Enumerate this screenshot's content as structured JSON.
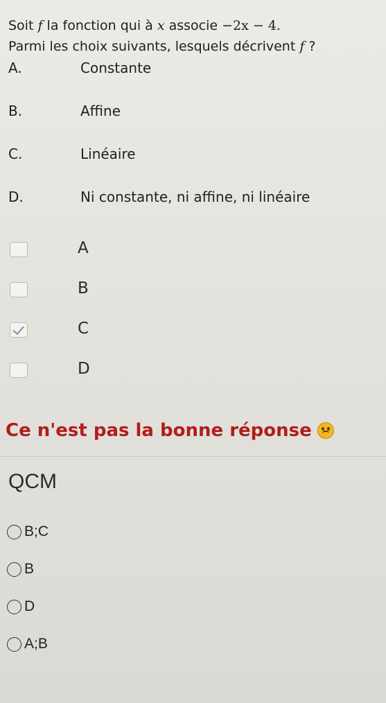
{
  "question": {
    "line1_prefix": "Soit ",
    "line1_f": "f",
    "line1_mid": " la fonction qui à ",
    "line1_x": "x",
    "line1_assoc": " associe ",
    "line1_expr": "−2x − 4.",
    "line2": "Parmi les choix suivants, lesquels décrivent ",
    "line2_f": "f",
    "line2_end": " ?"
  },
  "choices": [
    {
      "letter": "A.",
      "text": "Constante"
    },
    {
      "letter": "B.",
      "text": "Affine"
    },
    {
      "letter": "C.",
      "text": "Linéaire"
    },
    {
      "letter": "D.",
      "text": "Ni constante, ni affine, ni linéaire"
    }
  ],
  "answers": [
    {
      "label": "A",
      "checked": false
    },
    {
      "label": "B",
      "checked": false
    },
    {
      "label": "C",
      "checked": true
    },
    {
      "label": "D",
      "checked": false
    }
  ],
  "feedback": {
    "text": "Ce n'est pas la bonne réponse",
    "icon": "sad-face-icon",
    "color": "#b11d1d"
  },
  "qcm": {
    "title": "QCM",
    "options": [
      {
        "label": "B;C"
      },
      {
        "label": "B"
      },
      {
        "label": "D"
      },
      {
        "label": "A;B"
      }
    ]
  }
}
